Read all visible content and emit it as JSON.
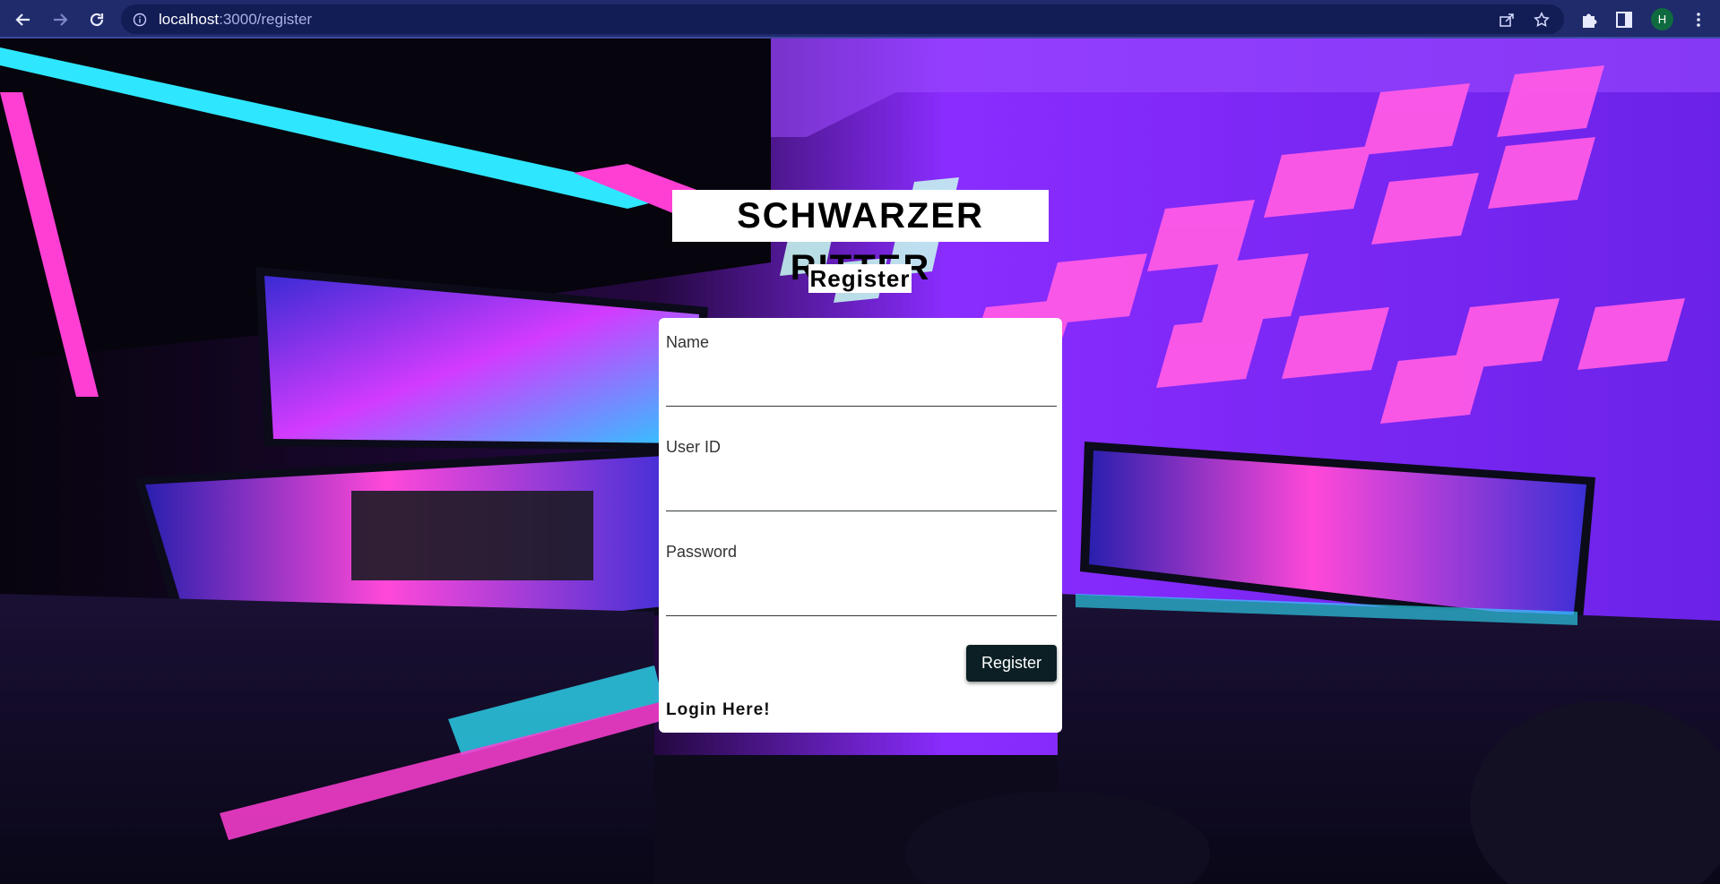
{
  "browser": {
    "url_host": "localhost",
    "url_path": ":3000/register",
    "profile_initial": "H"
  },
  "icons": {
    "back": "arrow-left-icon",
    "forward": "arrow-right-icon",
    "reload": "reload-icon",
    "info": "info-icon",
    "share": "share-icon",
    "bookmark": "star-icon",
    "extensions": "puzzle-icon",
    "side_panel": "side-panel-icon",
    "menu": "kebab-menu-icon"
  },
  "page": {
    "site_title": "SCHWARZER RITTER",
    "form_heading": "Register",
    "fields": [
      {
        "label": "Name",
        "value": ""
      },
      {
        "label": "User ID",
        "value": ""
      },
      {
        "label": "Password",
        "value": ""
      }
    ],
    "submit_label": "Register",
    "login_link": "Login Here!"
  },
  "colors": {
    "chrome_bg": "#1f2b6b",
    "button_bg": "#0b1f24",
    "neon_pink": "#ff3fd4",
    "neon_cyan": "#2fe6ff",
    "wall_purple": "#7b2cff"
  }
}
